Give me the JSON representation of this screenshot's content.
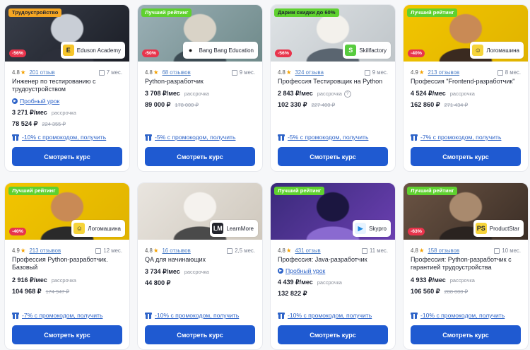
{
  "colors": {
    "accent": "#1f5ad1",
    "link": "#2d63c8",
    "discount": "#e8344c",
    "tag_green": "#5fd12f",
    "tag_orange": "#f5a623",
    "star": "#f4a100"
  },
  "icons": {
    "rating": "star-icon",
    "duration": "calendar-icon",
    "promo": "gift-icon",
    "trial": "play-icon",
    "installment_help": "question-icon"
  },
  "cards": [
    {
      "tag": "Трудоустройство",
      "tag_color": "#f5a623",
      "tag_text_color": "#1f2330",
      "discount": "-56%",
      "school": "Eduson Academy",
      "logo": "E",
      "logo_bg": "#f6c52b",
      "logo_fg": "#1f2330",
      "rating": "4.8",
      "reviews": "201 отзыв",
      "duration": "7 мес.",
      "title": "Инженер по тестированию с трудоустройством",
      "trial": "Пробный урок",
      "price_month": "3 271 ₽/мес",
      "installment": "рассрочка",
      "installment_help": false,
      "price": "78 524 ₽",
      "price_old": "224 355 ₽",
      "promo": "-10% с промокодом, получить",
      "button": "Смотреть курс",
      "scene": [
        "#3a3f4b",
        "#1b1e26",
        "#c9ced6",
        "#2c2f3a"
      ]
    },
    {
      "tag": "Лучший рейтинг",
      "tag_color": "#5fd12f",
      "tag_text_color": "#ffffff",
      "discount": "-50%",
      "school": "Bang Bang Education",
      "logo": "●",
      "logo_bg": "#ffffff",
      "logo_fg": "#111111",
      "rating": "4.8",
      "reviews": "68 отзывов",
      "duration": "9 мес.",
      "title": "Python-разработчик",
      "trial": "",
      "price_month": "3 708 ₽/мес",
      "installment": "рассрочка",
      "installment_help": false,
      "price": "89 000 ₽",
      "price_old": "178 000 ₽",
      "promo": "-5% с промокодом, получить",
      "button": "Смотреть курс",
      "scene": [
        "#9bb0b6",
        "#6f8a8a",
        "#d9d3c7",
        "#3b4a52"
      ]
    },
    {
      "tag": "Дарим скидки до 60%",
      "tag_color": "#5fd12f",
      "tag_text_color": "#1f2330",
      "discount": "-56%",
      "school": "Skillfactory",
      "logo": "S",
      "logo_bg": "#58cc3f",
      "logo_fg": "#ffffff",
      "rating": "4.8",
      "reviews": "324 отзыва",
      "duration": "9 мес.",
      "title": "Профессия Тестировщик на Python",
      "trial": "",
      "price_month": "2 843 ₽/мес",
      "installment": "рассрочка",
      "installment_help": true,
      "price": "102 330 ₽",
      "price_old": "227 400 ₽",
      "promo": "-5% с промокодом, получить",
      "button": "Смотреть курс",
      "scene": [
        "#dfe3e6",
        "#bfc5c9",
        "#f3f1ec",
        "#5a6570"
      ]
    },
    {
      "tag": "Лучший рейтинг",
      "tag_color": "#5fd12f",
      "tag_text_color": "#ffffff",
      "discount": "-40%",
      "school": "Логомашина",
      "logo": "☺",
      "logo_bg": "#f6d43a",
      "logo_fg": "#1f2330",
      "rating": "4.9",
      "reviews": "213 отзывов",
      "duration": "8 мес.",
      "title": "Профессия \"Frontend-разработчик\"",
      "trial": "",
      "price_month": "4 524 ₽/мес",
      "installment": "рассрочка",
      "installment_help": false,
      "price": "162 860 ₽",
      "price_old": "271 434 ₽",
      "promo": "-7% с промокодом, получить",
      "button": "Смотреть курс",
      "scene": [
        "#f2c500",
        "#e0b300",
        "#c98a55",
        "#3a2a20"
      ]
    },
    {
      "tag": "Лучший рейтинг",
      "tag_color": "#5fd12f",
      "tag_text_color": "#ffffff",
      "discount": "-40%",
      "school": "Логомашина",
      "logo": "☺",
      "logo_bg": "#f6d43a",
      "logo_fg": "#1f2330",
      "rating": "4.9",
      "reviews": "213 отзывов",
      "duration": "12 мес.",
      "title": "Профессия Python-разработчик. Базовый",
      "trial": "",
      "price_month": "2 916 ₽/мес",
      "installment": "рассрочка",
      "installment_help": false,
      "price": "104 968 ₽",
      "price_old": "174 947 ₽",
      "promo": "-7% с промокодом, получить",
      "button": "Смотреть курс",
      "scene": [
        "#f2c500",
        "#e0b300",
        "#c98a55",
        "#2a2a2a"
      ]
    },
    {
      "tag": "",
      "tag_color": "#5fd12f",
      "tag_text_color": "#ffffff",
      "discount": "",
      "school": "LearnMore",
      "logo": "LM",
      "logo_bg": "#22242c",
      "logo_fg": "#ffffff",
      "rating": "4.8",
      "reviews": "16 отзывов",
      "duration": "2,5 мес.",
      "title": "QA для начинающих",
      "trial": "",
      "price_month": "3 734 ₽/мес",
      "installment": "рассрочка",
      "installment_help": false,
      "price": "44 800 ₽",
      "price_old": "",
      "promo": "-10% с промокодом, получить",
      "button": "Смотреть курс",
      "scene": [
        "#e9e5df",
        "#cfc8bd",
        "#f5f2ee",
        "#4a4a4a"
      ]
    },
    {
      "tag": "Лучший рейтинг",
      "tag_color": "#5fd12f",
      "tag_text_color": "#ffffff",
      "discount": "",
      "school": "Skypro",
      "logo": "▶",
      "logo_bg": "#e6f3ff",
      "logo_fg": "#1f8be0",
      "rating": "4.8",
      "reviews": "431 отзыв",
      "duration": "11 мес.",
      "title": "Профессия: Java-разработчик",
      "trial": "Пробный урок",
      "price_month": "4 439 ₽/мес",
      "installment": "рассрочка",
      "installment_help": false,
      "price": "132 822 ₽",
      "price_old": "",
      "promo": "-10% с промокодом, получить",
      "button": "Смотреть курс",
      "scene": [
        "#3a2a7a",
        "#6a3fb0",
        "#1b1640",
        "#8a6ad0"
      ]
    },
    {
      "tag": "Лучший рейтинг",
      "tag_color": "#5fd12f",
      "tag_text_color": "#ffffff",
      "discount": "-63%",
      "school": "ProductStar",
      "logo": "PS",
      "logo_bg": "#f6d43a",
      "logo_fg": "#1f2330",
      "rating": "4.8",
      "reviews": "158 отзывов",
      "duration": "10 мес.",
      "title": "Профессия: Python-разработчик с гарантией трудоустройства",
      "trial": "",
      "price_month": "4 933 ₽/мес",
      "installment": "рассрочка",
      "installment_help": false,
      "price": "106 560 ₽",
      "price_old": "288 000 ₽",
      "promo": "-10% с промокодом, получить",
      "button": "Смотреть курс",
      "scene": [
        "#6b5444",
        "#3b2e26",
        "#a98a6e",
        "#2a2320"
      ]
    }
  ]
}
